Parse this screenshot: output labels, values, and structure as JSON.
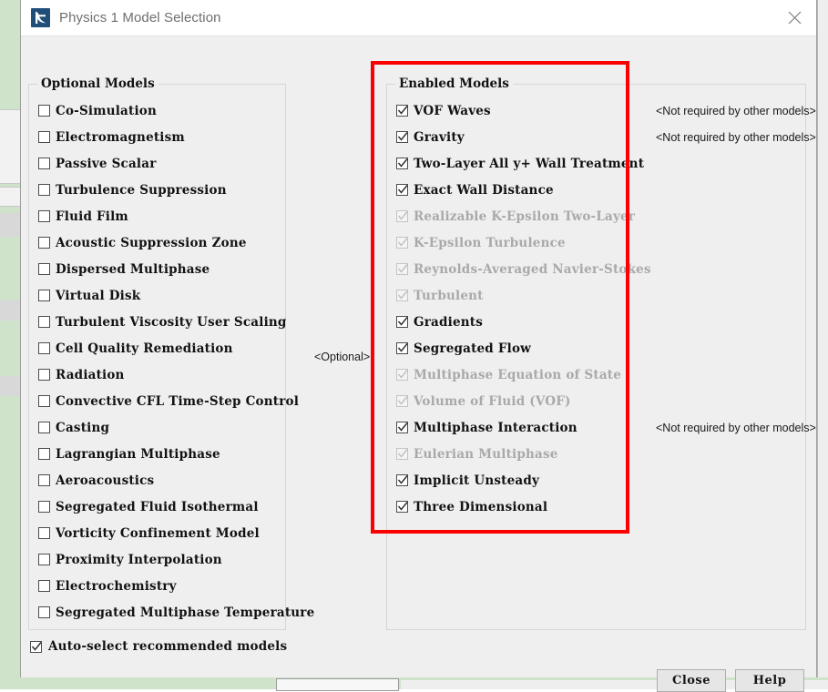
{
  "window": {
    "title": "Physics 1 Model Selection",
    "icon": "starccm-logo-icon",
    "close_label": "×"
  },
  "optional_group": {
    "title": "Optional Models",
    "items": [
      {
        "label": "Co-Simulation",
        "checked": false,
        "enabled": true
      },
      {
        "label": "Electromagnetism",
        "checked": false,
        "enabled": true
      },
      {
        "label": "Passive Scalar",
        "checked": false,
        "enabled": true
      },
      {
        "label": "Turbulence Suppression",
        "checked": false,
        "enabled": true
      },
      {
        "label": "Fluid Film",
        "checked": false,
        "enabled": true
      },
      {
        "label": "Acoustic Suppression Zone",
        "checked": false,
        "enabled": true
      },
      {
        "label": "Dispersed Multiphase",
        "checked": false,
        "enabled": true
      },
      {
        "label": "Virtual Disk",
        "checked": false,
        "enabled": true
      },
      {
        "label": "Turbulent Viscosity User Scaling",
        "checked": false,
        "enabled": true
      },
      {
        "label": "Cell Quality Remediation",
        "checked": false,
        "enabled": true
      },
      {
        "label": "Radiation",
        "checked": false,
        "enabled": true
      },
      {
        "label": "Convective CFL Time-Step Control",
        "checked": false,
        "enabled": true
      },
      {
        "label": "Casting",
        "checked": false,
        "enabled": true
      },
      {
        "label": "Lagrangian Multiphase",
        "checked": false,
        "enabled": true
      },
      {
        "label": "Aeroacoustics",
        "checked": false,
        "enabled": true
      },
      {
        "label": "Segregated Fluid Isothermal",
        "checked": false,
        "enabled": true
      },
      {
        "label": "Vorticity Confinement Model",
        "checked": false,
        "enabled": true
      },
      {
        "label": "Proximity Interpolation",
        "checked": false,
        "enabled": true
      },
      {
        "label": "Electrochemistry",
        "checked": false,
        "enabled": true
      },
      {
        "label": "Segregated Multiphase Temperature",
        "checked": false,
        "enabled": true
      }
    ]
  },
  "optional_connector_label": "<Optional>",
  "enabled_group": {
    "title": "Enabled Models",
    "items": [
      {
        "label": "VOF Waves",
        "checked": true,
        "enabled": true,
        "note": "<Not required by other models>"
      },
      {
        "label": "Gravity",
        "checked": true,
        "enabled": true,
        "note": "<Not required by other models>"
      },
      {
        "label": "Two-Layer All y+ Wall Treatment",
        "checked": true,
        "enabled": true,
        "note": ""
      },
      {
        "label": "Exact Wall Distance",
        "checked": true,
        "enabled": true,
        "note": ""
      },
      {
        "label": "Realizable K-Epsilon Two-Layer",
        "checked": true,
        "enabled": false,
        "note": ""
      },
      {
        "label": "K-Epsilon Turbulence",
        "checked": true,
        "enabled": false,
        "note": ""
      },
      {
        "label": "Reynolds-Averaged Navier-Stokes",
        "checked": true,
        "enabled": false,
        "note": ""
      },
      {
        "label": "Turbulent",
        "checked": true,
        "enabled": false,
        "note": ""
      },
      {
        "label": "Gradients",
        "checked": true,
        "enabled": true,
        "note": ""
      },
      {
        "label": "Segregated Flow",
        "checked": true,
        "enabled": true,
        "note": ""
      },
      {
        "label": "Multiphase Equation of State",
        "checked": true,
        "enabled": false,
        "note": ""
      },
      {
        "label": "Volume of Fluid (VOF)",
        "checked": true,
        "enabled": false,
        "note": ""
      },
      {
        "label": "Multiphase Interaction",
        "checked": true,
        "enabled": true,
        "note": "<Not required by other models>"
      },
      {
        "label": "Eulerian Multiphase",
        "checked": true,
        "enabled": false,
        "note": ""
      },
      {
        "label": "Implicit Unsteady",
        "checked": true,
        "enabled": true,
        "note": ""
      },
      {
        "label": "Three Dimensional",
        "checked": true,
        "enabled": true,
        "note": ""
      }
    ]
  },
  "auto_select": {
    "label": "Auto-select recommended models",
    "checked": true
  },
  "buttons": {
    "close": "Close",
    "help": "Help"
  },
  "annotation": {
    "color": "#fb0000"
  }
}
